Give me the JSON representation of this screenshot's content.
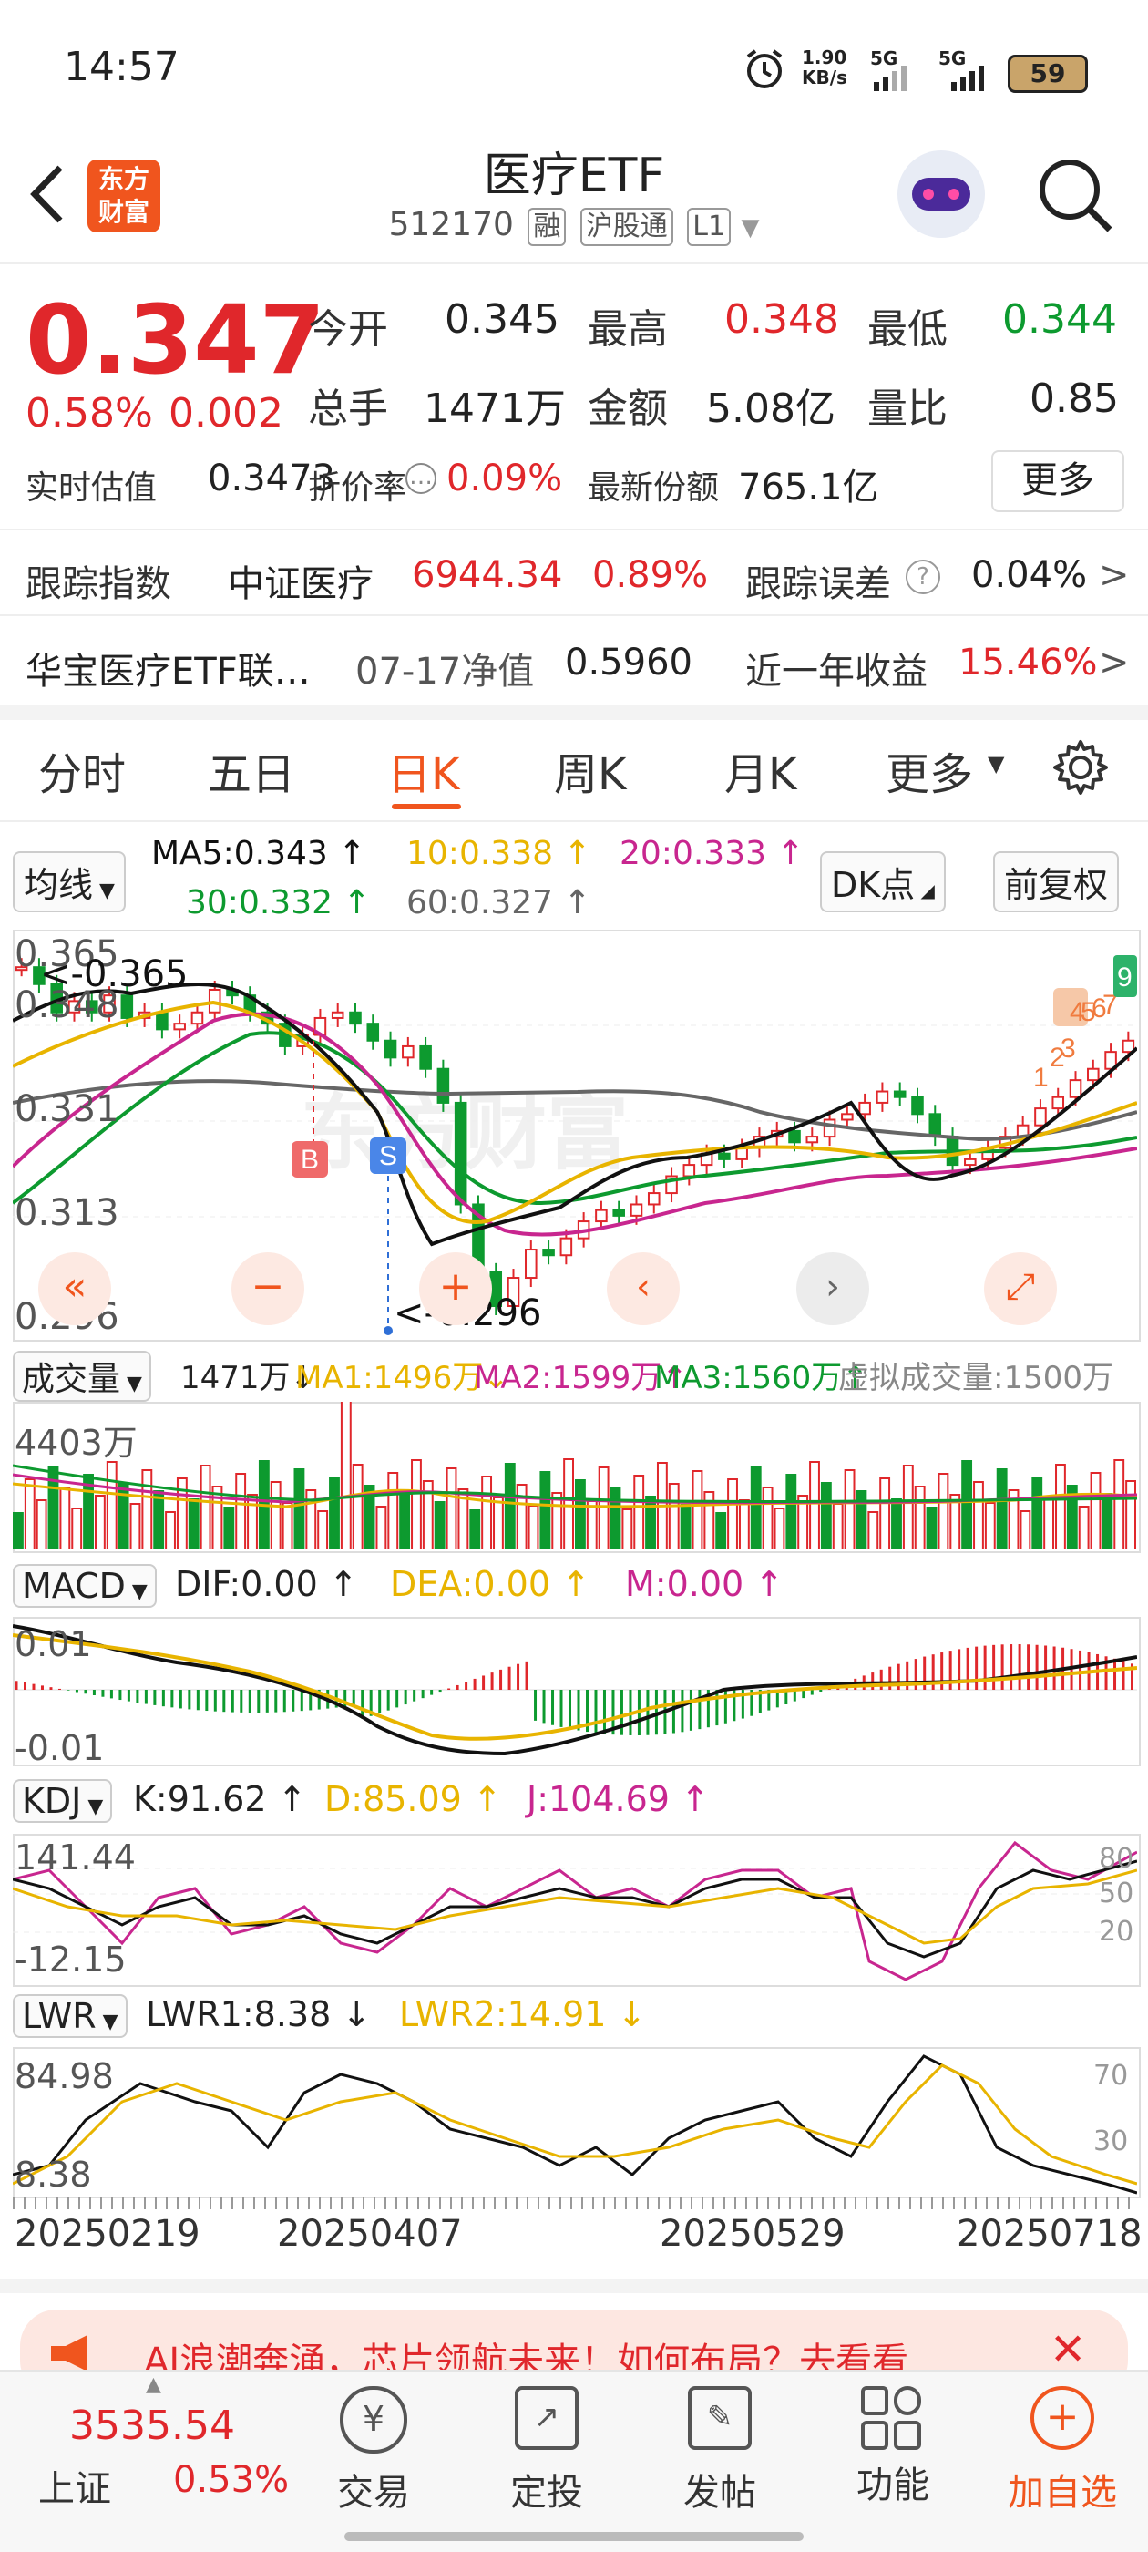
{
  "status": {
    "time": "14:57",
    "net_speed": "1.90\nKB/s",
    "sig1": "5G",
    "sig2": "5G",
    "battery": "59"
  },
  "header": {
    "title": "医疗ETF",
    "code": "512170",
    "tags": [
      "融",
      "沪股通",
      "L1"
    ],
    "logo_text": "东方\n财富"
  },
  "quote": {
    "price": "0.347",
    "change_pct": "0.58%",
    "change": "0.002",
    "open_label": "今开",
    "open": "0.345",
    "high_label": "最高",
    "high": "0.348",
    "low_label": "最低",
    "low": "0.344",
    "vol_label": "总手",
    "vol": "1471万",
    "amt_label": "金额",
    "amt": "5.08亿",
    "ratio_label": "量比",
    "ratio": "0.85",
    "est_label": "实时估值",
    "est": "0.3473",
    "disc_label": "折价率",
    "disc": "0.09%",
    "share_label": "最新份额",
    "share": "765.1亿",
    "more": "更多"
  },
  "tracking": {
    "label": "跟踪指数",
    "index": "中证医疗",
    "index_val": "6944.34",
    "index_pct": "0.89%",
    "err_label": "跟踪误差",
    "err": "0.04%"
  },
  "fund": {
    "name": "华宝医疗ETF联…",
    "nav_label": "07-17净值",
    "nav": "0.5960",
    "ret_label": "近一年收益",
    "ret": "15.46%"
  },
  "tabs": [
    "分时",
    "五日",
    "日K",
    "周K",
    "月K",
    "更多"
  ],
  "active_tab": 2,
  "ma": {
    "selector": "均线",
    "ma5": "MA5:0.343 ↑",
    "ma10": "10:0.338 ↑",
    "ma20": "20:0.333 ↑",
    "ma30": "30:0.332 ↑",
    "ma60": "60:0.327 ↑",
    "dk": "DK点",
    "fq": "前复权"
  },
  "kline_labels": {
    "y_top": "0.365",
    "y2": "0.348",
    "y3": "0.331",
    "y4": "0.313",
    "y_bot": "0.296",
    "hi_mark": "<-0.365",
    "lo_mark": "<-0.296",
    "b": "B",
    "s": "S",
    "counts": [
      "1",
      "2",
      "3",
      "4",
      "5",
      "6",
      "7",
      "9"
    ]
  },
  "volume": {
    "selector": "成交量",
    "val": "1471万↓",
    "ma1": "MA1:1496万↓",
    "ma2": "MA2:1599万↑",
    "ma3": "MA3:1560万↑",
    "virtual": "虚拟成交量:1500万",
    "y_top": "4403万"
  },
  "macd": {
    "selector": "MACD",
    "dif": "DIF:0.00 ↑",
    "dea": "DEA:0.00 ↑",
    "m": "M:0.00 ↑",
    "y_top": "0.01",
    "y_bot": "-0.01"
  },
  "kdj": {
    "selector": "KDJ",
    "k": "K:91.62 ↑",
    "d": "D:85.09 ↑",
    "j": "J:104.69 ↑",
    "y_top": "141.44",
    "y_bot": "-12.15",
    "r80": "80",
    "r50": "50",
    "r20": "20"
  },
  "lwr": {
    "selector": "LWR",
    "l1": "LWR1:8.38 ↓",
    "l2": "LWR2:14.91 ↓",
    "y_top": "84.98",
    "y_bot": "8.38",
    "r70": "70",
    "r30": "30"
  },
  "dates": [
    "20250219",
    "20250407",
    "20250529",
    "20250718"
  ],
  "banner": "AI浪潮奔涌，芯片领航未来！如何布局？去看看",
  "bottom": {
    "index_val": "3535.54",
    "index_name": "上证",
    "index_pct": "0.53%",
    "items": [
      "交易",
      "定投",
      "发帖",
      "功能",
      "加自选"
    ]
  },
  "colors": {
    "up": "#e0272b",
    "down": "#0d9a2f",
    "accent": "#f0551e",
    "ma5": "#111111",
    "ma10": "#e8b400",
    "ma20": "#c8268f",
    "ma30": "#0d9a2f",
    "ma60": "#666666"
  }
}
